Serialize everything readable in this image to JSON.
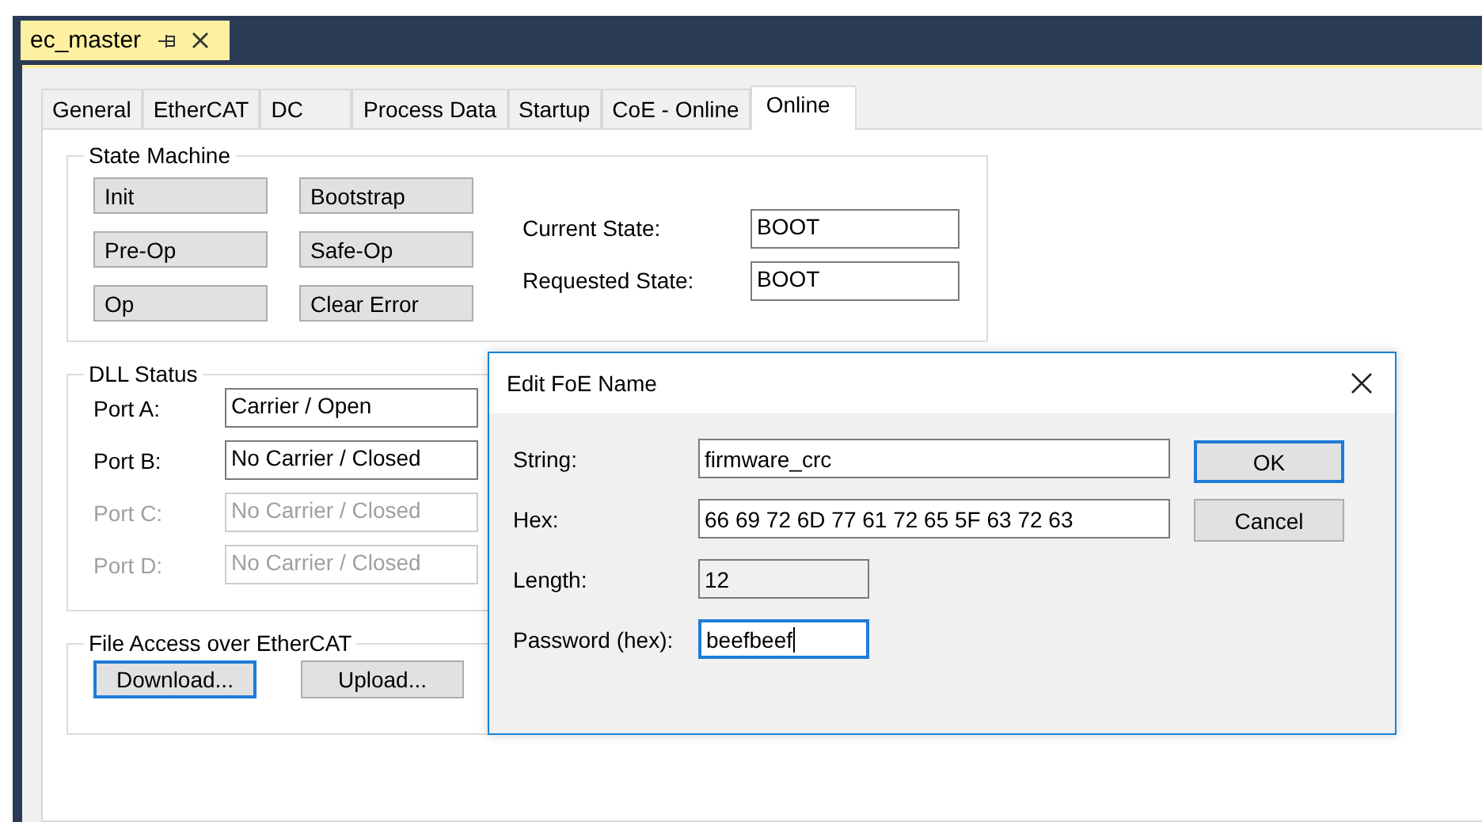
{
  "document_tab": {
    "title": "ec_master"
  },
  "tabs": [
    {
      "label": "General",
      "selected": false
    },
    {
      "label": "EtherCAT",
      "selected": false
    },
    {
      "label": "DC",
      "selected": false
    },
    {
      "label": "Process Data",
      "selected": false
    },
    {
      "label": "Startup",
      "selected": false
    },
    {
      "label": "CoE - Online",
      "selected": false
    },
    {
      "label": "Online",
      "selected": true
    }
  ],
  "state_machine": {
    "title": "State Machine",
    "buttons": [
      "Init",
      "Bootstrap",
      "Pre-Op",
      "Safe-Op",
      "Op",
      "Clear Error"
    ],
    "states": [
      {
        "label": "Current State:",
        "value": "BOOT"
      },
      {
        "label": "Requested State:",
        "value": "BOOT"
      }
    ]
  },
  "dll_status": {
    "title": "DLL Status",
    "ports": [
      {
        "label": "Port A:",
        "value": "Carrier / Open",
        "disabled": false
      },
      {
        "label": "Port B:",
        "value": "No Carrier / Closed",
        "disabled": false
      },
      {
        "label": "Port C:",
        "value": "No Carrier / Closed",
        "disabled": true
      },
      {
        "label": "Port D:",
        "value": "No Carrier / Closed",
        "disabled": true
      }
    ]
  },
  "foe": {
    "title": "File Access over EtherCAT",
    "buttons": [
      {
        "label": "Download...",
        "focused": true
      },
      {
        "label": "Upload...",
        "focused": false
      }
    ]
  },
  "dialog": {
    "title": "Edit FoE Name",
    "fields": [
      {
        "label": "String:",
        "value": "firmware_crc",
        "kind": "wide",
        "readonly": false,
        "focused": false
      },
      {
        "label": "Hex:",
        "value": "66 69 72 6D 77 61 72 65 5F 63 72 63",
        "kind": "wide",
        "readonly": false,
        "focused": false
      },
      {
        "label": "Length:",
        "value": "12",
        "kind": "short",
        "readonly": true,
        "focused": false
      },
      {
        "label": "Password (hex):",
        "value": "beefbeef",
        "kind": "short",
        "readonly": false,
        "focused": true
      }
    ],
    "buttons": [
      {
        "label": "OK",
        "focused": true
      },
      {
        "label": "Cancel",
        "focused": false
      }
    ]
  }
}
